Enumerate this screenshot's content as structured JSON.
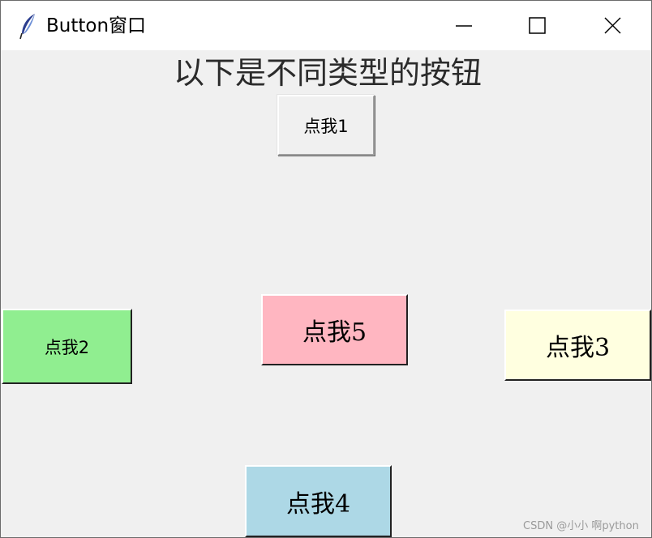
{
  "window": {
    "title": "Button窗口",
    "app_icon": "feather-icon",
    "controls": {
      "minimize_icon": "minimize-icon",
      "maximize_icon": "maximize-icon",
      "close_icon": "close-icon"
    }
  },
  "main": {
    "heading": "以下是不同类型的按钮",
    "buttons": [
      {
        "label": "点我1",
        "bg": "#f0f0f0"
      },
      {
        "label": "点我2",
        "bg": "#90ee90"
      },
      {
        "label": "点我3",
        "bg": "#ffffe0"
      },
      {
        "label": "点我4",
        "bg": "#add8e6"
      },
      {
        "label": "点我5",
        "bg": "#ffb6c1"
      }
    ]
  },
  "watermark": "CSDN @小小 啊python",
  "colors": {
    "window_bg": "#f0f0f0",
    "titlebar_bg": "#ffffff",
    "btn_green": "#90ee90",
    "btn_pink": "#ffb6c1",
    "btn_yellow": "#ffffe0",
    "btn_blue": "#add8e6"
  }
}
